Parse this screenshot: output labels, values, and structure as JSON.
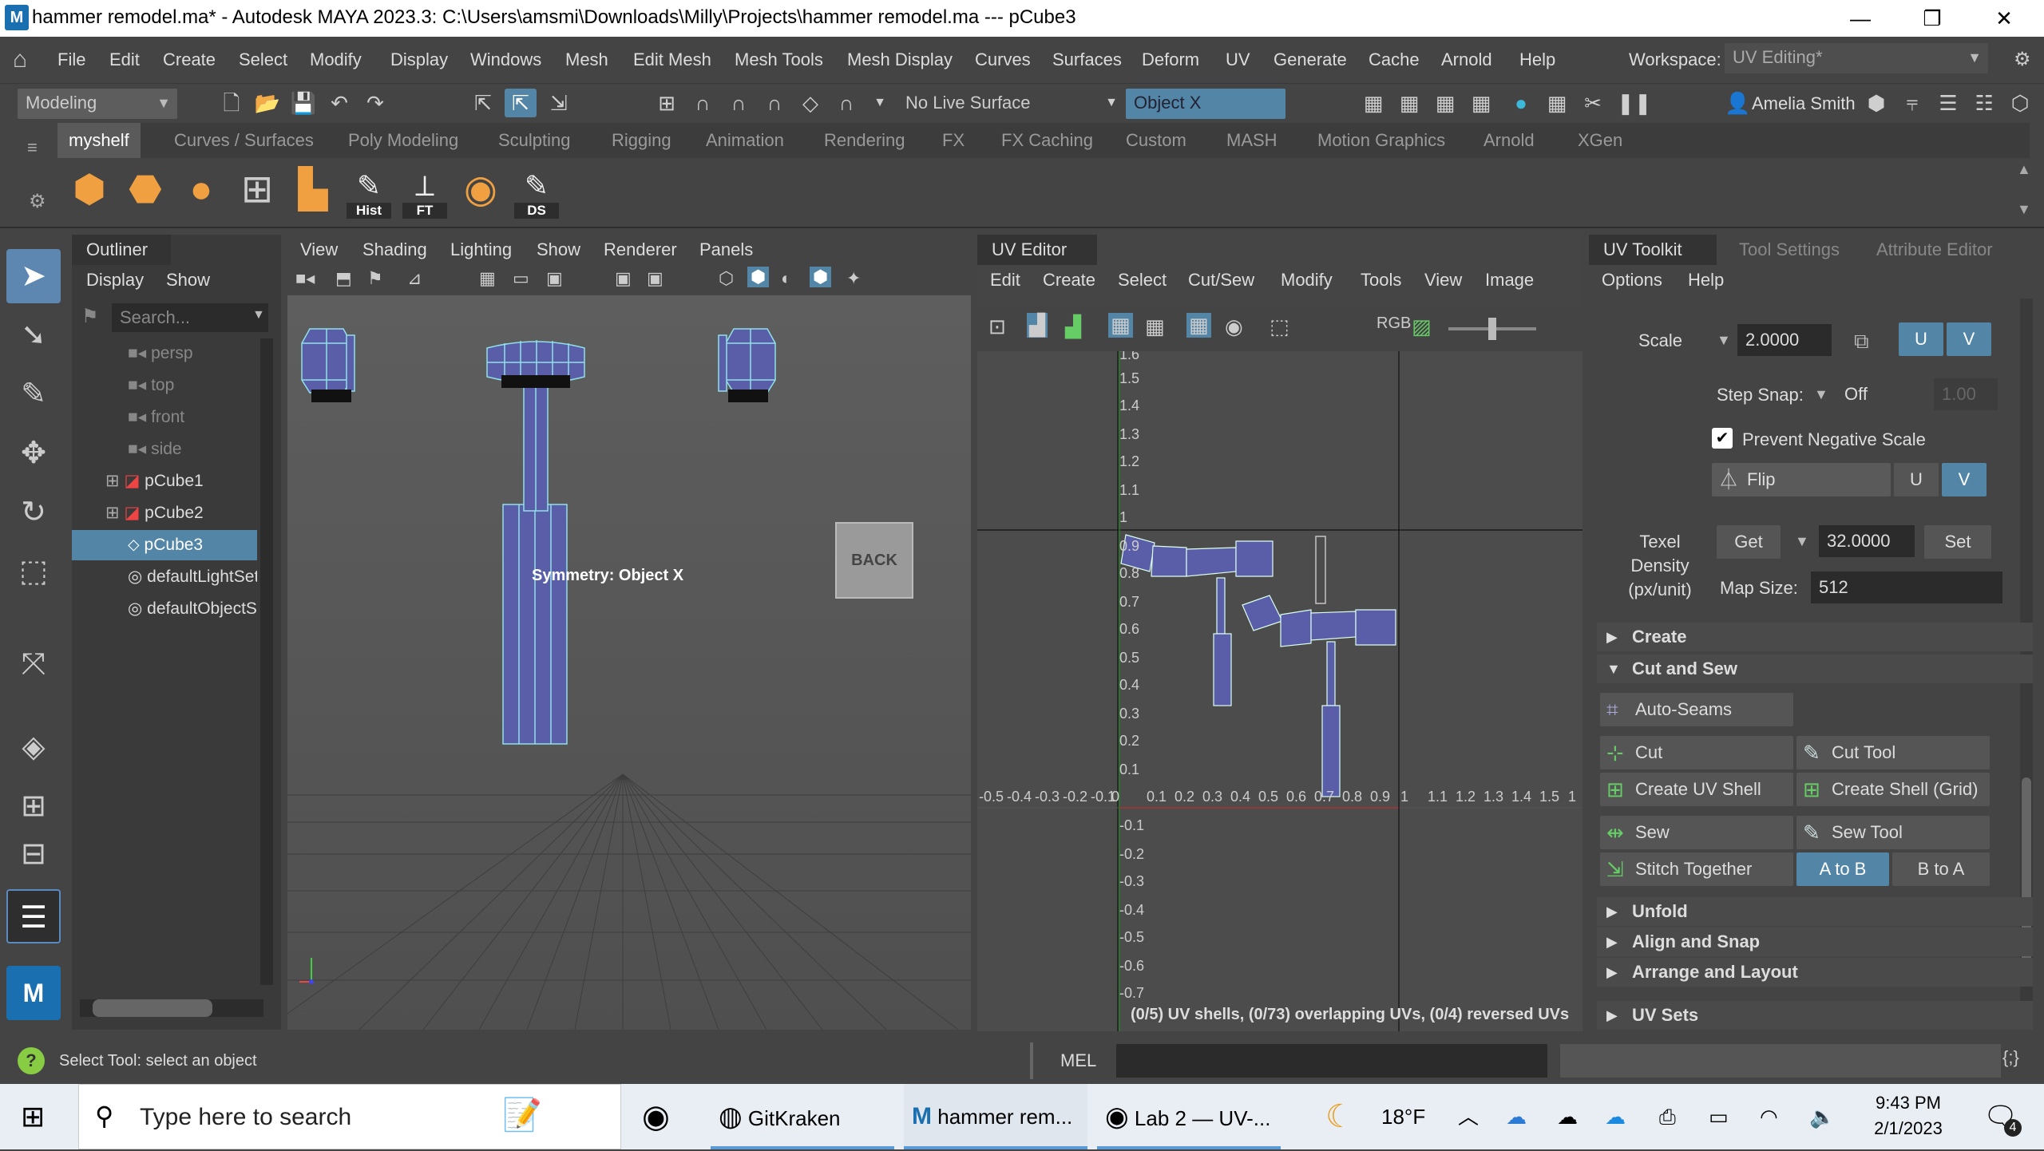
{
  "titlebar": {
    "logo": "M",
    "title": "hammer remodel.ma* - Autodesk MAYA 2023.3: C:\\Users\\amsmi\\Downloads\\Milly\\Projects\\hammer remodel.ma   ---   pCube3",
    "minimize": "—",
    "maximize": "❐",
    "close": "✕"
  },
  "menubar": {
    "items": [
      "File",
      "Edit",
      "Create",
      "Select",
      "Modify",
      "Display",
      "Windows",
      "Mesh",
      "Edit Mesh",
      "Mesh Tools",
      "Mesh Display",
      "Curves",
      "Surfaces",
      "Deform",
      "UV",
      "Generate",
      "Cache",
      "Arnold",
      "Help"
    ],
    "workspace_label": "Workspace:",
    "workspace_value": "UV Editing*"
  },
  "statusline": {
    "mode": "Modeling",
    "live_surface": "No Live Surface",
    "symmetry": "Object X",
    "user": "Amelia Smith"
  },
  "shelf": {
    "tabs": [
      "myshelf",
      "Curves / Surfaces",
      "Poly Modeling",
      "Sculpting",
      "Rigging",
      "Animation",
      "Rendering",
      "FX",
      "FX Caching",
      "Custom",
      "MASH",
      "Motion Graphics",
      "Arnold",
      "XGen"
    ],
    "labels": {
      "hist": "Hist",
      "ft": "FT",
      "ds": "DS"
    }
  },
  "outliner": {
    "title": "Outliner",
    "menu": [
      "Display",
      "Show"
    ],
    "search_placeholder": "Search...",
    "items": [
      {
        "name": "persp",
        "state": "dim"
      },
      {
        "name": "top",
        "state": "dim"
      },
      {
        "name": "front",
        "state": "dim"
      },
      {
        "name": "side",
        "state": "dim"
      },
      {
        "name": "pCube1",
        "state": "normal"
      },
      {
        "name": "pCube2",
        "state": "normal"
      },
      {
        "name": "pCube3",
        "state": "selected"
      },
      {
        "name": "defaultLightSet",
        "state": "normal"
      },
      {
        "name": "defaultObjectSet",
        "state": "normal"
      }
    ]
  },
  "viewport": {
    "menu": [
      "View",
      "Shading",
      "Lighting",
      "Show",
      "Renderer",
      "Panels"
    ],
    "symmetry_label": "Symmetry: Object X",
    "back_label": "BACK",
    "axis_y": "y",
    "axis_x": "x",
    "axis_z": "z"
  },
  "uv_editor": {
    "title": "UV Editor",
    "menu": [
      "Edit",
      "Create",
      "Select",
      "Cut/Sew",
      "Modify",
      "Tools",
      "View",
      "Image"
    ],
    "y_ticks": [
      "1.6",
      "1.5",
      "1.4",
      "1.3",
      "1.2",
      "1.1",
      "1",
      "0.9",
      "0.8",
      "0.7",
      "0.6",
      "0.5",
      "0.4",
      "0.3",
      "0.2",
      "0.1",
      "-0.1",
      "-0.2",
      "-0.3",
      "-0.4",
      "-0.5",
      "-0.6",
      "-0.7"
    ],
    "x_ticks": [
      "-0.5",
      "-0.4",
      "-0.3",
      "-0.2",
      "-0.1",
      "0",
      "0.1",
      "0.2",
      "0.3",
      "0.4",
      "0.5",
      "0.6",
      "0.7",
      "0.8",
      "0.9",
      "1",
      "1.1",
      "1.2",
      "1.3",
      "1.4",
      "1.5",
      "1"
    ],
    "status": "(0/5) UV shells, (0/73) overlapping UVs, (0/4) reversed UVs"
  },
  "toolkit": {
    "tabs": [
      "UV Toolkit",
      "Tool Settings",
      "Attribute Editor"
    ],
    "menu": [
      "Options",
      "Help"
    ],
    "scale_label": "Scale",
    "scale_value": "2.0000",
    "u_label": "U",
    "v_label": "V",
    "step_snap_label": "Step Snap:",
    "step_snap_value": "Off",
    "step_snap_amount": "1.00",
    "prevent_negative_scale": "Prevent Negative Scale",
    "flip_label": "Flip",
    "texel_density_label": "Texel\nDensity\n(px/unit)",
    "get_label": "Get",
    "texel_value": "32.0000",
    "set_label": "Set",
    "map_size_label": "Map Size:",
    "map_size_value": "512",
    "sections": {
      "create": "Create",
      "cut_and_sew": "Cut and Sew",
      "unfold": "Unfold",
      "align_snap": "Align and Snap",
      "arrange": "Arrange and Layout",
      "uv_sets": "UV Sets"
    },
    "buttons": {
      "auto_seams": "Auto-Seams",
      "cut": "Cut",
      "cut_tool": "Cut Tool",
      "create_uv_shell": "Create UV Shell",
      "create_shell_grid": "Create Shell (Grid)",
      "sew": "Sew",
      "sew_tool": "Sew Tool",
      "stitch_together": "Stitch Together",
      "a_to_b": "A to B",
      "b_to_a": "B to A"
    }
  },
  "helpline": {
    "text": "Select Tool: select an object",
    "mel": "MEL"
  },
  "taskbar": {
    "search_placeholder": "Type here to search",
    "apps": [
      {
        "label": "GitKraken"
      },
      {
        "label": "hammer rem..."
      },
      {
        "label": "Lab 2 — UV-..."
      }
    ],
    "temperature": "18°F",
    "time": "9:43 PM",
    "date": "2/1/2023",
    "notifications": "4"
  },
  "colors": {
    "accent": "#5285a6",
    "mesh": "#5a5ea8",
    "mesh_edge": "#8fe0e8"
  }
}
